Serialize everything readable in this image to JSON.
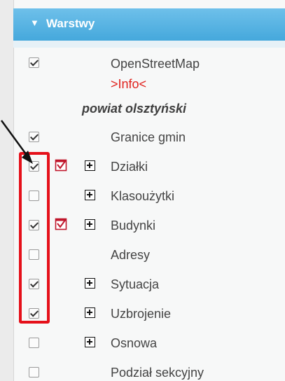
{
  "panel": {
    "title": "Warstwy",
    "group_label": "powiat olsztyński"
  },
  "layers": [
    {
      "label": "OpenStreetMap",
      "link": ">Info<",
      "checked": true,
      "info_icon": false,
      "expandable": false
    },
    {
      "label": "Granice gmin",
      "checked": true,
      "info_icon": false,
      "expandable": false
    },
    {
      "label": "Działki",
      "checked": true,
      "info_icon": true,
      "expandable": true
    },
    {
      "label": "Klasoużytki",
      "checked": false,
      "info_icon": false,
      "expandable": true
    },
    {
      "label": "Budynki",
      "checked": true,
      "info_icon": true,
      "expandable": true
    },
    {
      "label": "Adresy",
      "checked": false,
      "info_icon": false,
      "expandable": false
    },
    {
      "label": "Sytuacja",
      "checked": true,
      "info_icon": false,
      "expandable": true
    },
    {
      "label": "Uzbrojenie",
      "checked": true,
      "info_icon": false,
      "expandable": true
    },
    {
      "label": "Osnowa",
      "checked": false,
      "info_icon": false,
      "expandable": true
    },
    {
      "label": "Podział sekcyjny",
      "checked": false,
      "info_icon": false,
      "expandable": false
    }
  ],
  "colors": {
    "header": "#45a8dc",
    "link": "#e0221d",
    "highlight_box": "#e5101a"
  }
}
